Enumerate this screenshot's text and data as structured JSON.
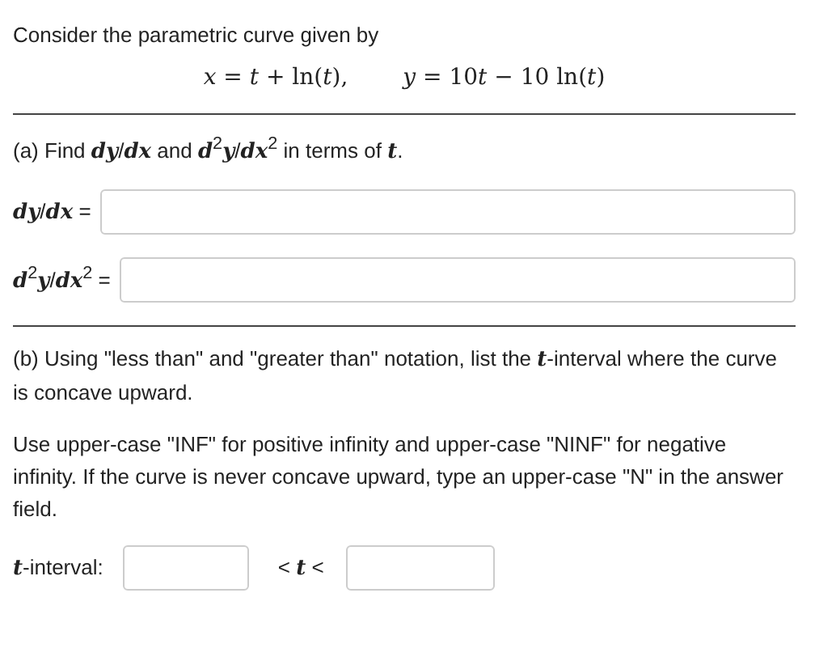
{
  "intro": "Consider the parametric curve given by",
  "equations": [
    [
      "*x* = *t* + ln(*t*),"
    ],
    [
      "*y* = 10",
      "*t* − 10 ln(*t*)"
    ]
  ],
  "part_a": {
    "prompt": "(a) Find *dy*/*dx* and *d*$^{2}$*y*/*dx*$^{2}$ in terms of *t*.",
    "fields": [
      {
        "label": "*dy*/*dx* ="
      },
      {
        "label": "*d*$^{2}$*y*/*dx*$^{2}$ ="
      }
    ]
  },
  "part_b": {
    "prompt": "(b) Using \"less than\" and \"greater than\" notation, list the *t*-interval where the curve is concave upward.",
    "note": "Use upper-case \"INF\" for positive infinity and upper-case \"NINF\" for negative infinity. If the curve is never concave upward, type an upper-case \"N\" in the answer field.",
    "interval_label": "*t*-interval:",
    "between": "< *t* <"
  }
}
